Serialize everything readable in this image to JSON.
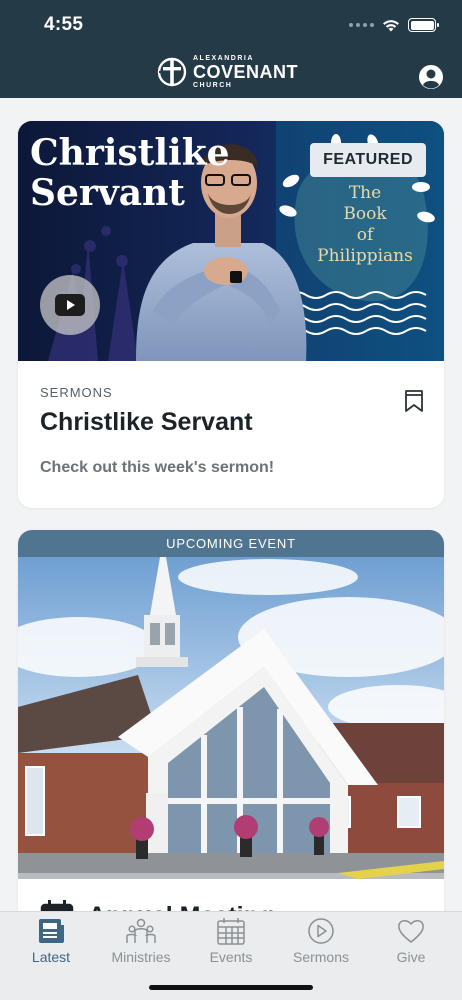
{
  "status_bar": {
    "time": "4:55"
  },
  "header": {
    "logo": {
      "top": "ALEXANDRIA",
      "main": "COVENANT",
      "bottom": "CHURCH"
    },
    "profile_icon": "person-icon"
  },
  "featured_card": {
    "hero_title_line1": "Christlike",
    "hero_title_line2": "Servant",
    "badge": "FEATURED",
    "series_line1": "The",
    "series_line2": "Book",
    "series_line3": "of",
    "series_line4": "Philippians",
    "category": "SERMONS",
    "title": "Christlike Servant",
    "description": "Check out this week's sermon!"
  },
  "event_card": {
    "banner": "UPCOMING EVENT",
    "title": "Annual Meeting"
  },
  "tabbar": {
    "items": [
      {
        "label": "Latest",
        "icon": "newspaper-icon",
        "active": true
      },
      {
        "label": "Ministries",
        "icon": "people-icon",
        "active": false
      },
      {
        "label": "Events",
        "icon": "calendar-icon",
        "active": false
      },
      {
        "label": "Sermons",
        "icon": "play-circle-icon",
        "active": false
      },
      {
        "label": "Give",
        "icon": "heart-icon",
        "active": false
      }
    ]
  },
  "colors": {
    "header_bg": "#253a47",
    "accent": "#3e6786",
    "event_banner": "#4f7590"
  }
}
